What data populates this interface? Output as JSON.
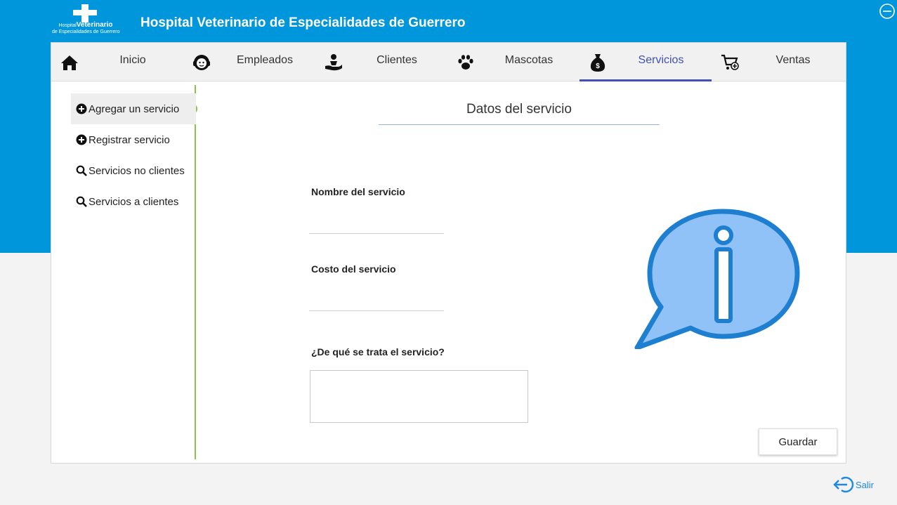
{
  "header": {
    "logo_word_small": "Hospital",
    "logo_word_big": "Veterinario",
    "logo_sub": "de Especialidades de Guerrero",
    "title": "Hospital Veterinario de Especialidades de Guerrero"
  },
  "nav": {
    "tabs": [
      {
        "label": "Inicio",
        "icon": "home-icon",
        "active": false
      },
      {
        "label": "Empleados",
        "icon": "headset-person-icon",
        "active": false
      },
      {
        "label": "Clientes",
        "icon": "hand-person-icon",
        "active": false
      },
      {
        "label": "Mascotas",
        "icon": "paw-icon",
        "active": false
      },
      {
        "label": "Servicios",
        "icon": "money-bag-icon",
        "active": true
      },
      {
        "label": "Ventas",
        "icon": "cart-add-icon",
        "active": false
      }
    ],
    "active_color": "#3f51b5"
  },
  "sidebar": {
    "items": [
      {
        "label": "Agregar un servicio",
        "icon": "plus-circle-icon",
        "active": true
      },
      {
        "label": "Registrar servicio",
        "icon": "plus-circle-icon",
        "active": false
      },
      {
        "label": "Servicios no clientes",
        "icon": "search-icon",
        "active": false
      },
      {
        "label": "Servicios a clientes",
        "icon": "search-icon",
        "active": false
      }
    ],
    "accent_color": "#8bc34a"
  },
  "form": {
    "title": "Datos del servicio",
    "name_label": "Nombre del servicio",
    "name_value": "",
    "cost_label": "Costo del servicio",
    "cost_value": "",
    "description_label": "¿De qué se trata el servicio?",
    "description_value": "",
    "save_label": "Guardar"
  },
  "footer": {
    "exit_label": "Salir",
    "exit_color": "#1e88e5"
  },
  "colors": {
    "brand_blue": "#0096db",
    "info_fill": "#90c2f7",
    "info_stroke": "#1e7fd0"
  }
}
